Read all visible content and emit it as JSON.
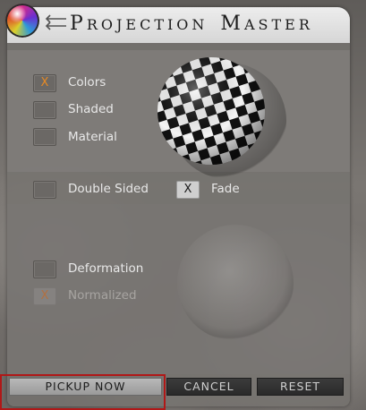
{
  "window": {
    "title_words": [
      {
        "cap": "P",
        "rest": "ROJECTION"
      },
      {
        "cap": "M",
        "rest": "ASTER"
      }
    ],
    "logo_icon": "projection-master-sphere-icon",
    "arrows_icon": "double-arrow-icon"
  },
  "options": {
    "colors": {
      "label": "Colors",
      "mark": "X",
      "checked": true
    },
    "shaded": {
      "label": "Shaded",
      "mark": "",
      "checked": false
    },
    "material": {
      "label": "Material",
      "mark": "",
      "checked": false
    },
    "double_sided": {
      "label": "Double Sided",
      "mark": "",
      "checked": false
    },
    "fade": {
      "label": "Fade",
      "mark": "X",
      "checked": true
    },
    "deformation": {
      "label": "Deformation",
      "mark": "",
      "checked": false
    },
    "normalized": {
      "label": "Normalized",
      "mark": "X",
      "checked": true,
      "disabled": true
    }
  },
  "preview": {
    "pattern": "checkerboard-sphere"
  },
  "buttons": {
    "pickup_now": "PICKUP NOW",
    "cancel": "CANCEL",
    "reset": "RESET"
  },
  "colors": {
    "accent_mark": "#e68a25",
    "highlight": "#b01818"
  }
}
